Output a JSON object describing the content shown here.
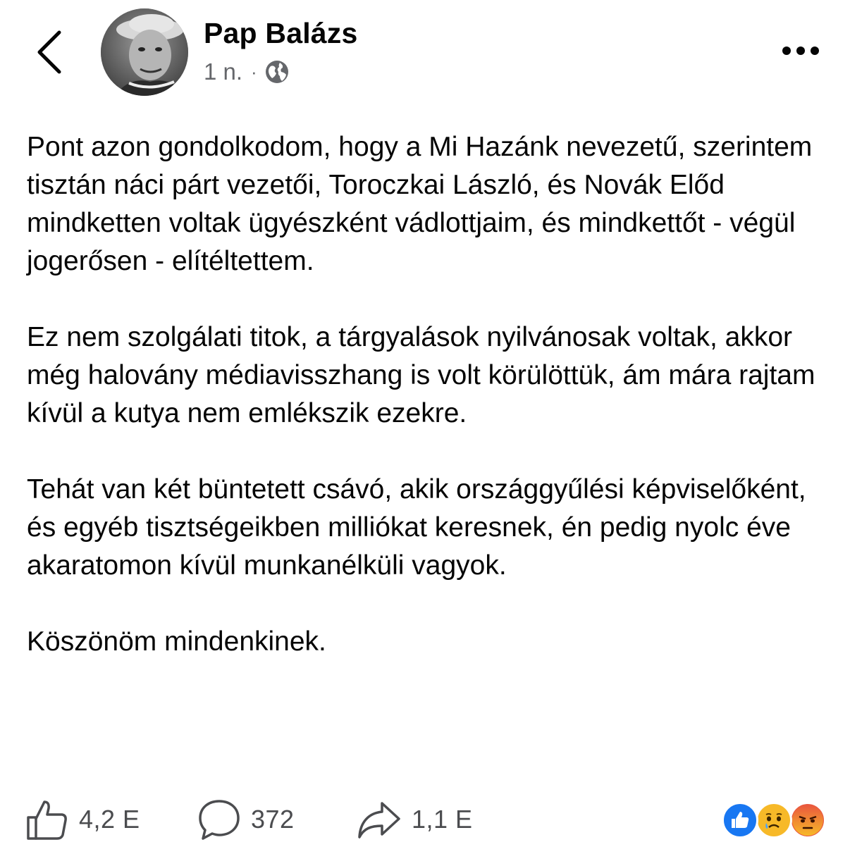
{
  "post": {
    "author": "Pap Balázs",
    "time": "1 n.",
    "separator": "·",
    "audience_icon": "globe-icon",
    "paragraphs": [
      "Pont azon gondolkodom, hogy a Mi Hazánk nevezetű, szerintem tisztán náci párt vezetői, Toroczkai László, és Novák Előd mindketten voltak ügyészként vádlottjaim, és mindkettőt - végül jogerősen - elítéltettem.",
      "Ez nem szolgálati titok, a tárgyalások nyilvánosak voltak, akkor még halovány médiavisszhang is volt körülöttük, ám mára rajtam kívül a kutya nem emlékszik ezekre.",
      "Tehát van két büntetett csávó, akik országgyűlési képviselőként, és egyéb tisztségeikben milliókat keresnek, én pedig nyolc éve akaratomon kívül munkanélküli vagyok.",
      "Köszönöm mindenkinek."
    ]
  },
  "actions": {
    "likes": "4,2 E",
    "comments": "372",
    "shares": "1,1 E"
  },
  "reactions": [
    "like",
    "sad",
    "angry"
  ],
  "colors": {
    "like_blue": "#1877f2",
    "sad_yellow": "#f7b928",
    "angry_red": "#e9573e",
    "secondary_text": "#65676b"
  }
}
